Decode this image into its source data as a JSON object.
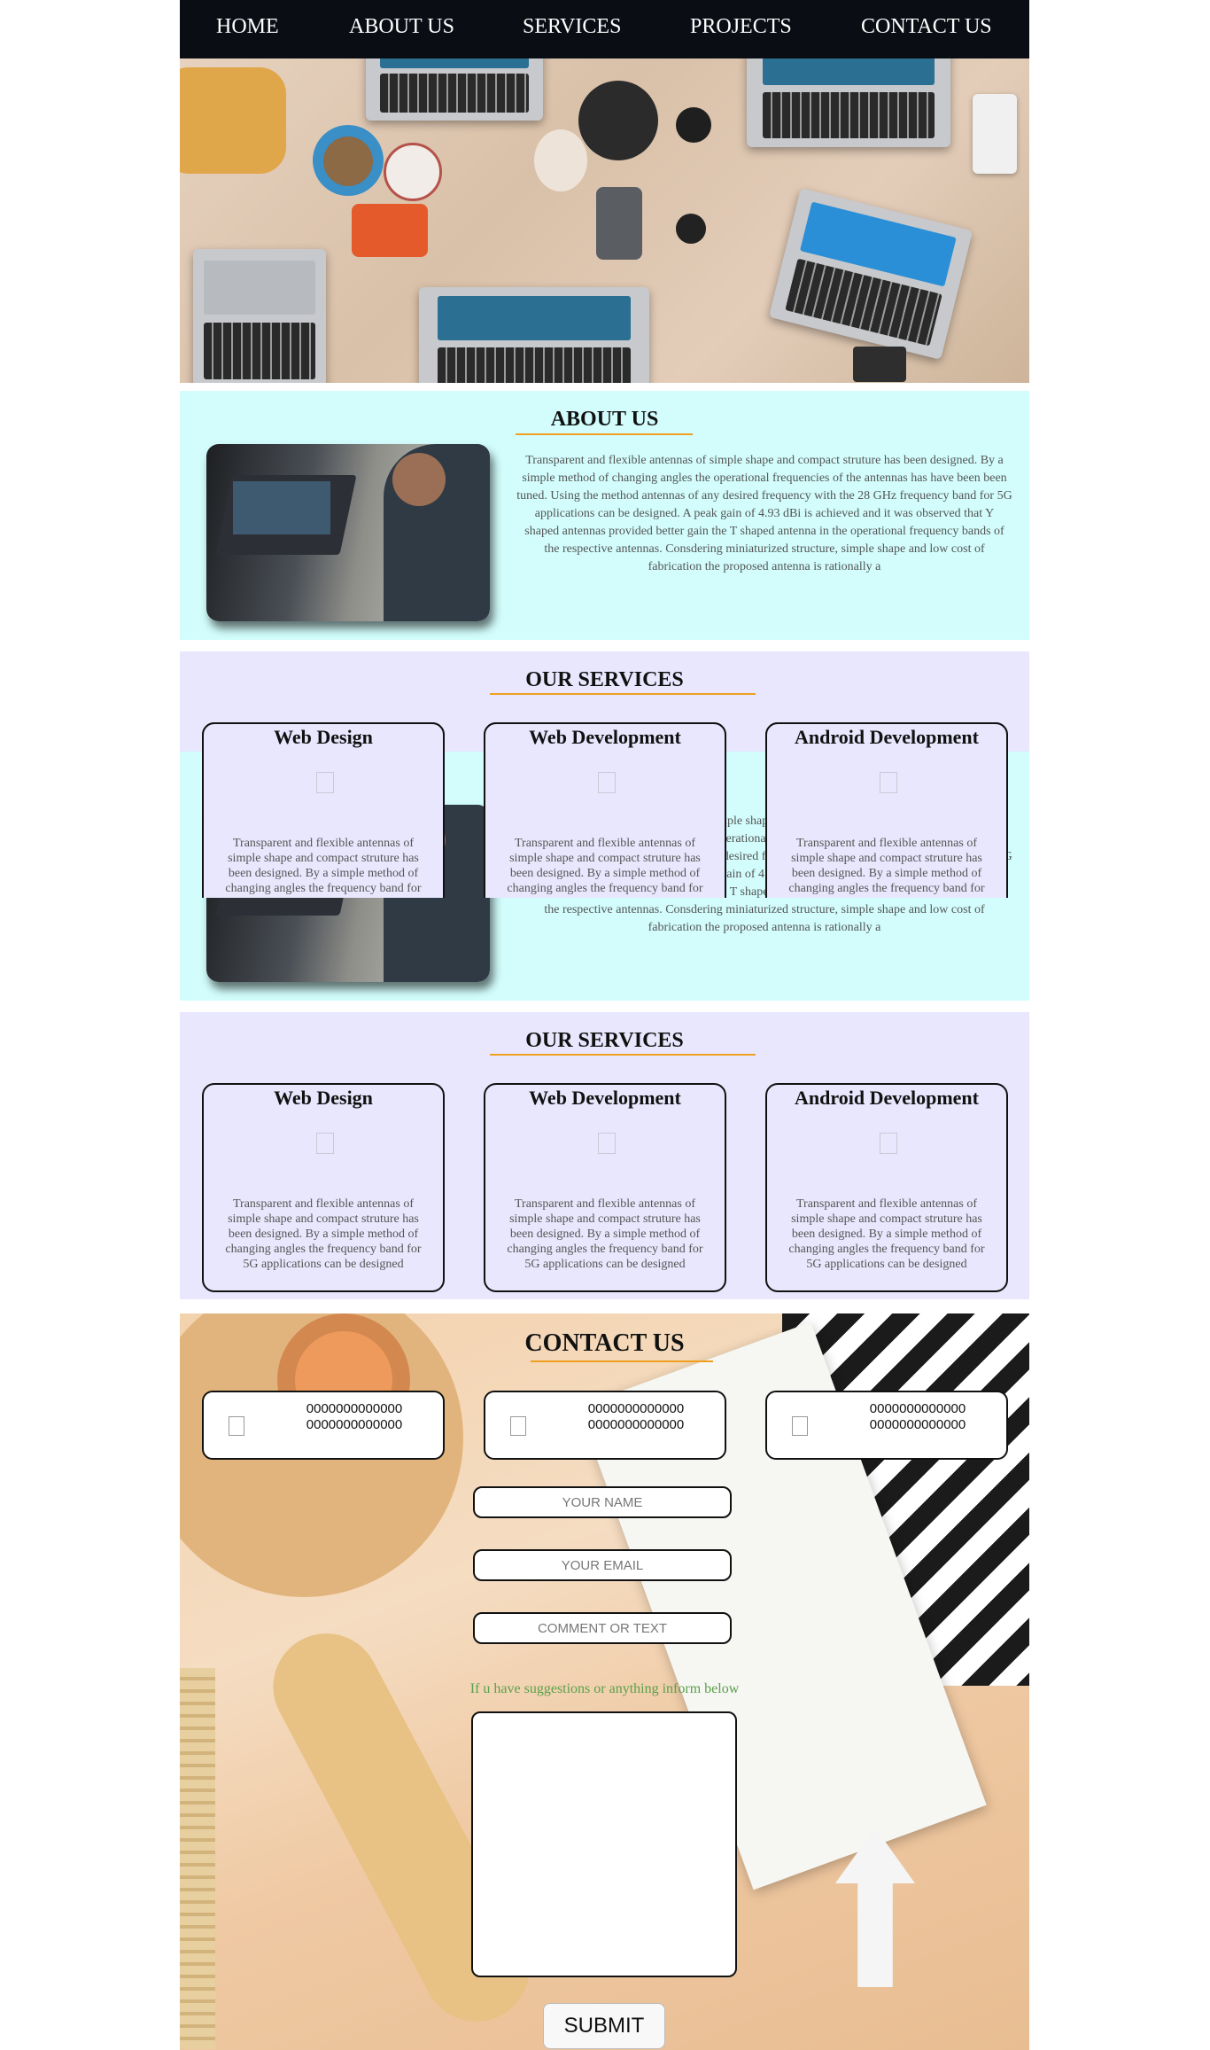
{
  "nav": {
    "items": [
      {
        "label": "HOME"
      },
      {
        "label": "ABOUT US"
      },
      {
        "label": "SERVICES"
      },
      {
        "label": "PROJECTS"
      },
      {
        "label": "CONTACT US"
      }
    ]
  },
  "about": {
    "title": "ABOUT US",
    "text": "Transparent and flexible antennas of simple shape and compact struture has been designed. By a simple method of changing angles the operational frequencies of the antennas has have been been tuned. Using the method antennas of any desired frequency with the 28 GHz frequency band for 5G applications can be designed. A peak gain of 4.93 dBi is achieved and it was observed that Y shaped antennas provided better gain the T shaped antenna in the operational frequency bands of the respective antennas. Consdering miniaturized structure, simple shape and low cost of fabrication the proposed antenna is rationally a"
  },
  "services": {
    "title": "OUR SERVICES",
    "cards": [
      {
        "name": "Web Design",
        "icon": "placeholder-icon",
        "text": "Transparent and flexible antennas of simple shape and compact struture has been designed. By a simple method of changing angles the frequency band for 5G applications can be designed"
      },
      {
        "name": "Web Development",
        "icon": "placeholder-icon",
        "text": "Transparent and flexible antennas of simple shape and compact struture has been designed. By a simple method of changing angles the frequency band for 5G applications can be designed"
      },
      {
        "name": "Android Development",
        "icon": "placeholder-icon",
        "text": "Transparent and flexible antennas of simple shape and compact struture has been designed. By a simple method of changing angles the frequency band for 5G applications can be designed"
      }
    ]
  },
  "contact": {
    "title": "CONTACT US",
    "cards": [
      {
        "line1": "0000000000000",
        "line2": "0000000000000"
      },
      {
        "line1": "0000000000000",
        "line2": "0000000000000"
      },
      {
        "line1": "0000000000000",
        "line2": "0000000000000"
      }
    ],
    "name_placeholder": "YOUR NAME",
    "email_placeholder": "YOUR EMAIL",
    "comment_placeholder": "COMMENT OR TEXT",
    "hint": "If u have suggestions or anything inform below",
    "submit_label": "SUBMIT"
  },
  "colors": {
    "nav_bg": "#0a0e14",
    "about_bg": "#d2fdfc",
    "services_bg": "#e8e7fd",
    "accent_line": "#f0a020",
    "hint_text": "#5aa04b"
  }
}
